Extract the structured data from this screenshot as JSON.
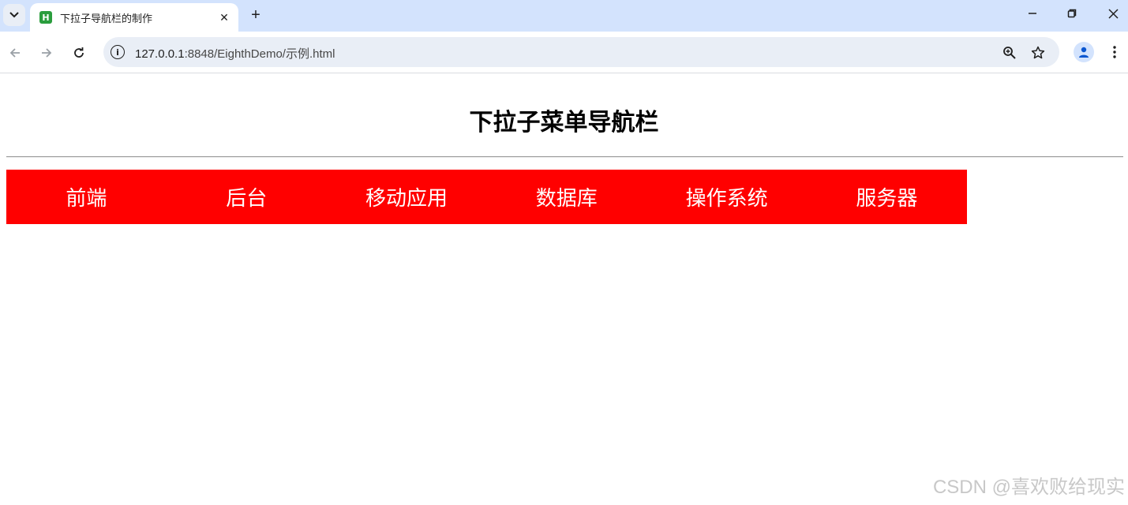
{
  "browser": {
    "tab_title": "下拉子导航栏的制作",
    "favicon_letter": "H",
    "address": {
      "host": "127.0.0.1",
      "rest": ":8848/EighthDemo/示例.html"
    }
  },
  "page": {
    "title": "下拉子菜单导航栏",
    "nav_color": "#ff0000",
    "nav_items": [
      "前端",
      "后台",
      "移动应用",
      "数据库",
      "操作系统",
      "服务器"
    ]
  },
  "watermark": "CSDN @喜欢败给现实"
}
